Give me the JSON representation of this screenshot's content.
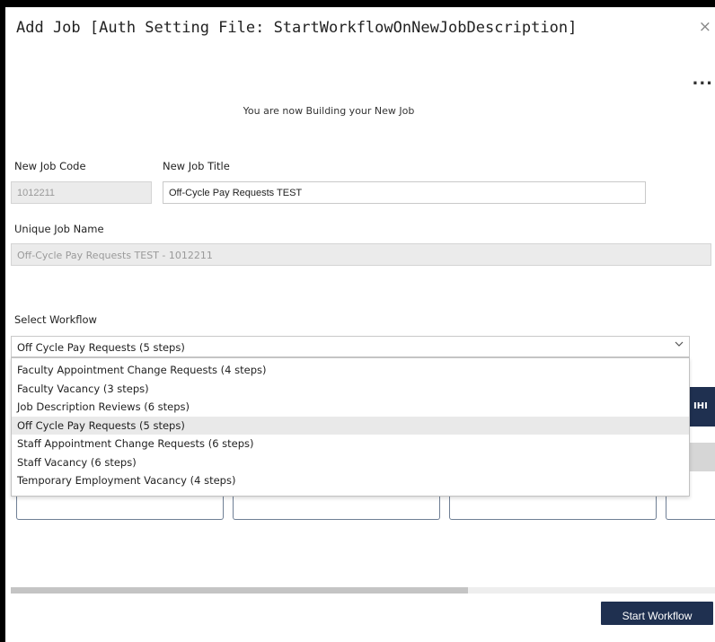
{
  "dialog": {
    "title": "Add Job [Auth Setting File: StartWorkflowOnNewJobDescription]",
    "close_label": "×",
    "more_label": "...",
    "subtitle": "You are now Building your New Job"
  },
  "form": {
    "job_code_label": "New Job Code",
    "job_code_value": "1012211",
    "job_title_label": "New Job Title",
    "job_title_value": "Off-Cycle Pay Requests TEST",
    "unique_name_label": "Unique Job Name",
    "unique_name_value": "Off-Cycle Pay Requests TEST - 1012211"
  },
  "workflow": {
    "label": "Select Workflow",
    "selected": "Off Cycle Pay Requests (5 steps)",
    "chevron_icon": "chevron-down-icon",
    "options": [
      "Faculty Appointment Change Requests (4 steps)",
      "Faculty Vacancy (3 steps)",
      "Job Description Reviews (6 steps)",
      "Off Cycle Pay Requests (5 steps)",
      "Staff Appointment Change Requests (6 steps)",
      "Staff Vacancy (6 steps)",
      "Temporary Employment Vacancy (4 steps)"
    ]
  },
  "background": {
    "partial_tab_text": "IHI"
  },
  "footer": {
    "start_label": "Start Workflow"
  },
  "colors": {
    "primary_navy": "#1f3050",
    "selected_option_bg": "#e9e9e9",
    "disabled_input_bg": "#ebebeb"
  }
}
